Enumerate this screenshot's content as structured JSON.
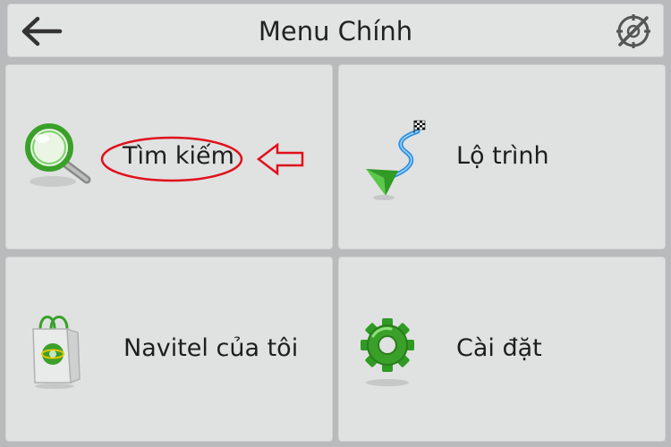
{
  "header": {
    "title": "Menu Chính",
    "back_icon": "arrow-left-icon",
    "gps_icon": "gps-off-icon"
  },
  "menu": {
    "items": [
      {
        "label": "Tìm kiếm",
        "icon": "magnifier-icon"
      },
      {
        "label": "Lộ trình",
        "icon": "route-icon"
      },
      {
        "label": "Navitel của tôi",
        "icon": "shopping-bag-icon"
      },
      {
        "label": "Cài đặt",
        "icon": "gear-icon"
      }
    ]
  },
  "annotation": {
    "color": "#e0101a"
  },
  "colors": {
    "background": "#b8babb",
    "tile": "#e0e1e1",
    "icon_green": "#3aa02a"
  }
}
